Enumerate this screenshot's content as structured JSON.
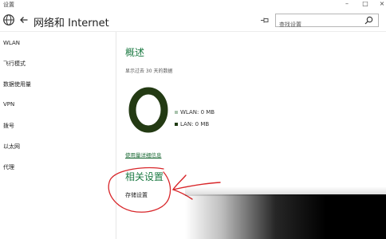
{
  "window": {
    "title": "设置",
    "minimize": "–",
    "maximize": "□",
    "close": "×"
  },
  "header": {
    "title": "网络和 Internet",
    "search_placeholder": "查找设置"
  },
  "sidebar": {
    "items": [
      {
        "label": "WLAN"
      },
      {
        "label": "飞行模式"
      },
      {
        "label": "数据使用量"
      },
      {
        "label": "VPN"
      },
      {
        "label": "拨号"
      },
      {
        "label": "以太网"
      },
      {
        "label": "代理"
      }
    ]
  },
  "main": {
    "overview_title": "概述",
    "overview_subtitle": "显示过去 30 天的数据",
    "usage": [
      {
        "label": "WLAN: 0 MB",
        "color": "#a9c3ad"
      },
      {
        "label": "LAN: 0 MB",
        "color": "#1f3a12"
      }
    ],
    "usage_details_link": "使用量详细信息",
    "related_title": "相关设置",
    "storage_link": "存储设置"
  },
  "colors": {
    "accent": "#1e7b44",
    "donut": "#233a13",
    "annotation": "#d8262a"
  }
}
